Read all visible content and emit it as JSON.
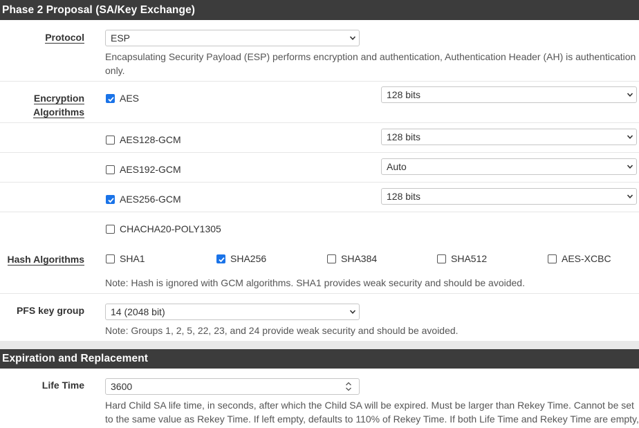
{
  "phase2": {
    "heading": "Phase 2 Proposal (SA/Key Exchange)",
    "protocol": {
      "label": "Protocol",
      "value": "ESP",
      "help": "Encapsulating Security Payload (ESP) performs encryption and authentication, Authentication Header (AH) is authentication only.",
      "help_line1": "Encapsulating Security Payload (ESP) performs encryption and authentication, Authentication Header (AH) is authentication",
      "help_line2": "only."
    },
    "encryption": {
      "label_line1": "Encryption",
      "label_line2": "Algorithms",
      "algorithms": [
        {
          "name": "AES",
          "checked": true,
          "key_length": "128 bits"
        },
        {
          "name": "AES128-GCM",
          "checked": false,
          "key_length": "128 bits"
        },
        {
          "name": "AES192-GCM",
          "checked": false,
          "key_length": "Auto"
        },
        {
          "name": "AES256-GCM",
          "checked": true,
          "key_length": "128 bits"
        },
        {
          "name": "CHACHA20-POLY1305",
          "checked": false,
          "key_length": ""
        }
      ]
    },
    "hash": {
      "label": "Hash Algorithms",
      "options": [
        {
          "name": "SHA1",
          "checked": false
        },
        {
          "name": "SHA256",
          "checked": true
        },
        {
          "name": "SHA384",
          "checked": false
        },
        {
          "name": "SHA512",
          "checked": false
        },
        {
          "name": "AES-XCBC",
          "checked": false
        }
      ],
      "note": "Note: Hash is ignored with GCM algorithms. SHA1 provides weak security and should be avoided."
    },
    "pfs": {
      "label": "PFS key group",
      "value": "14 (2048 bit)",
      "note": "Note: Groups 1, 2, 5, 22, 23, and 24 provide weak security and should be avoided."
    }
  },
  "expiration": {
    "heading": "Expiration and Replacement",
    "lifetime": {
      "label": "Life Time",
      "value": "3600",
      "help_line1": "Hard Child SA life time, in seconds, after which the Child SA will be expired. Must be larger than Rekey Time. Cannot be set",
      "help_line2": "to the same value as Rekey Time. If left empty, defaults to 110% of Rekey Time. If both Life Time and Rekey Time are empty,"
    }
  },
  "colors": {
    "heading_bg": "#3c3c3c",
    "checkbox_checked": "#1a73e8"
  },
  "icons": {
    "select_arrow": "chevron-down-icon",
    "checkmark": "check-icon",
    "number_spinner": "spinner-icon"
  }
}
